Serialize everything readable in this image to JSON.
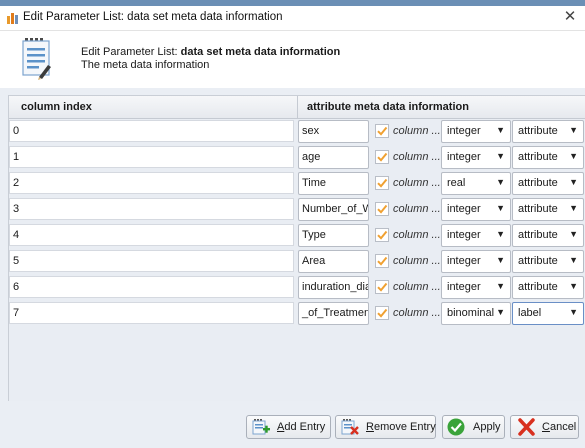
{
  "window": {
    "title": "Edit Parameter List: data set meta data information",
    "close_glyph": "✕",
    "app_icon": "rapidminer-icon"
  },
  "header": {
    "prefix": "Edit Parameter List: ",
    "param_name": "data set meta data information",
    "description": "The meta data information",
    "icon": "document-list-icon"
  },
  "table": {
    "col1_header": "column index",
    "col2_header": "attribute meta data information",
    "checkbox_label": "column ...",
    "rows": [
      {
        "index": "0",
        "name": "sex",
        "checked": true,
        "type": "integer",
        "role": "attribute"
      },
      {
        "index": "1",
        "name": "age",
        "checked": true,
        "type": "integer",
        "role": "attribute"
      },
      {
        "index": "2",
        "name": "Time",
        "checked": true,
        "type": "real",
        "role": "attribute"
      },
      {
        "index": "3",
        "name": "Number_of_W",
        "checked": true,
        "type": "integer",
        "role": "attribute"
      },
      {
        "index": "4",
        "name": "Type",
        "checked": true,
        "type": "integer",
        "role": "attribute"
      },
      {
        "index": "5",
        "name": "Area",
        "checked": true,
        "type": "integer",
        "role": "attribute"
      },
      {
        "index": "6",
        "name": "induration_dia",
        "checked": true,
        "type": "integer",
        "role": "attribute"
      },
      {
        "index": "7",
        "name": "_of_Treatment",
        "checked": true,
        "type": "binominal",
        "role": "label"
      }
    ]
  },
  "buttons": {
    "add": {
      "label_u": "A",
      "label_rest": "dd Entry"
    },
    "remove": {
      "label_u": "R",
      "label_rest": "emove Entry"
    },
    "apply": {
      "label": "Apply"
    },
    "cancel": {
      "label_u": "C",
      "label_rest": "ancel"
    }
  },
  "colors": {
    "checkbox": "#f0a030",
    "apply_green": "#3aa33a",
    "cancel_red": "#d8301f",
    "panel_bg": "#eaeef4"
  }
}
